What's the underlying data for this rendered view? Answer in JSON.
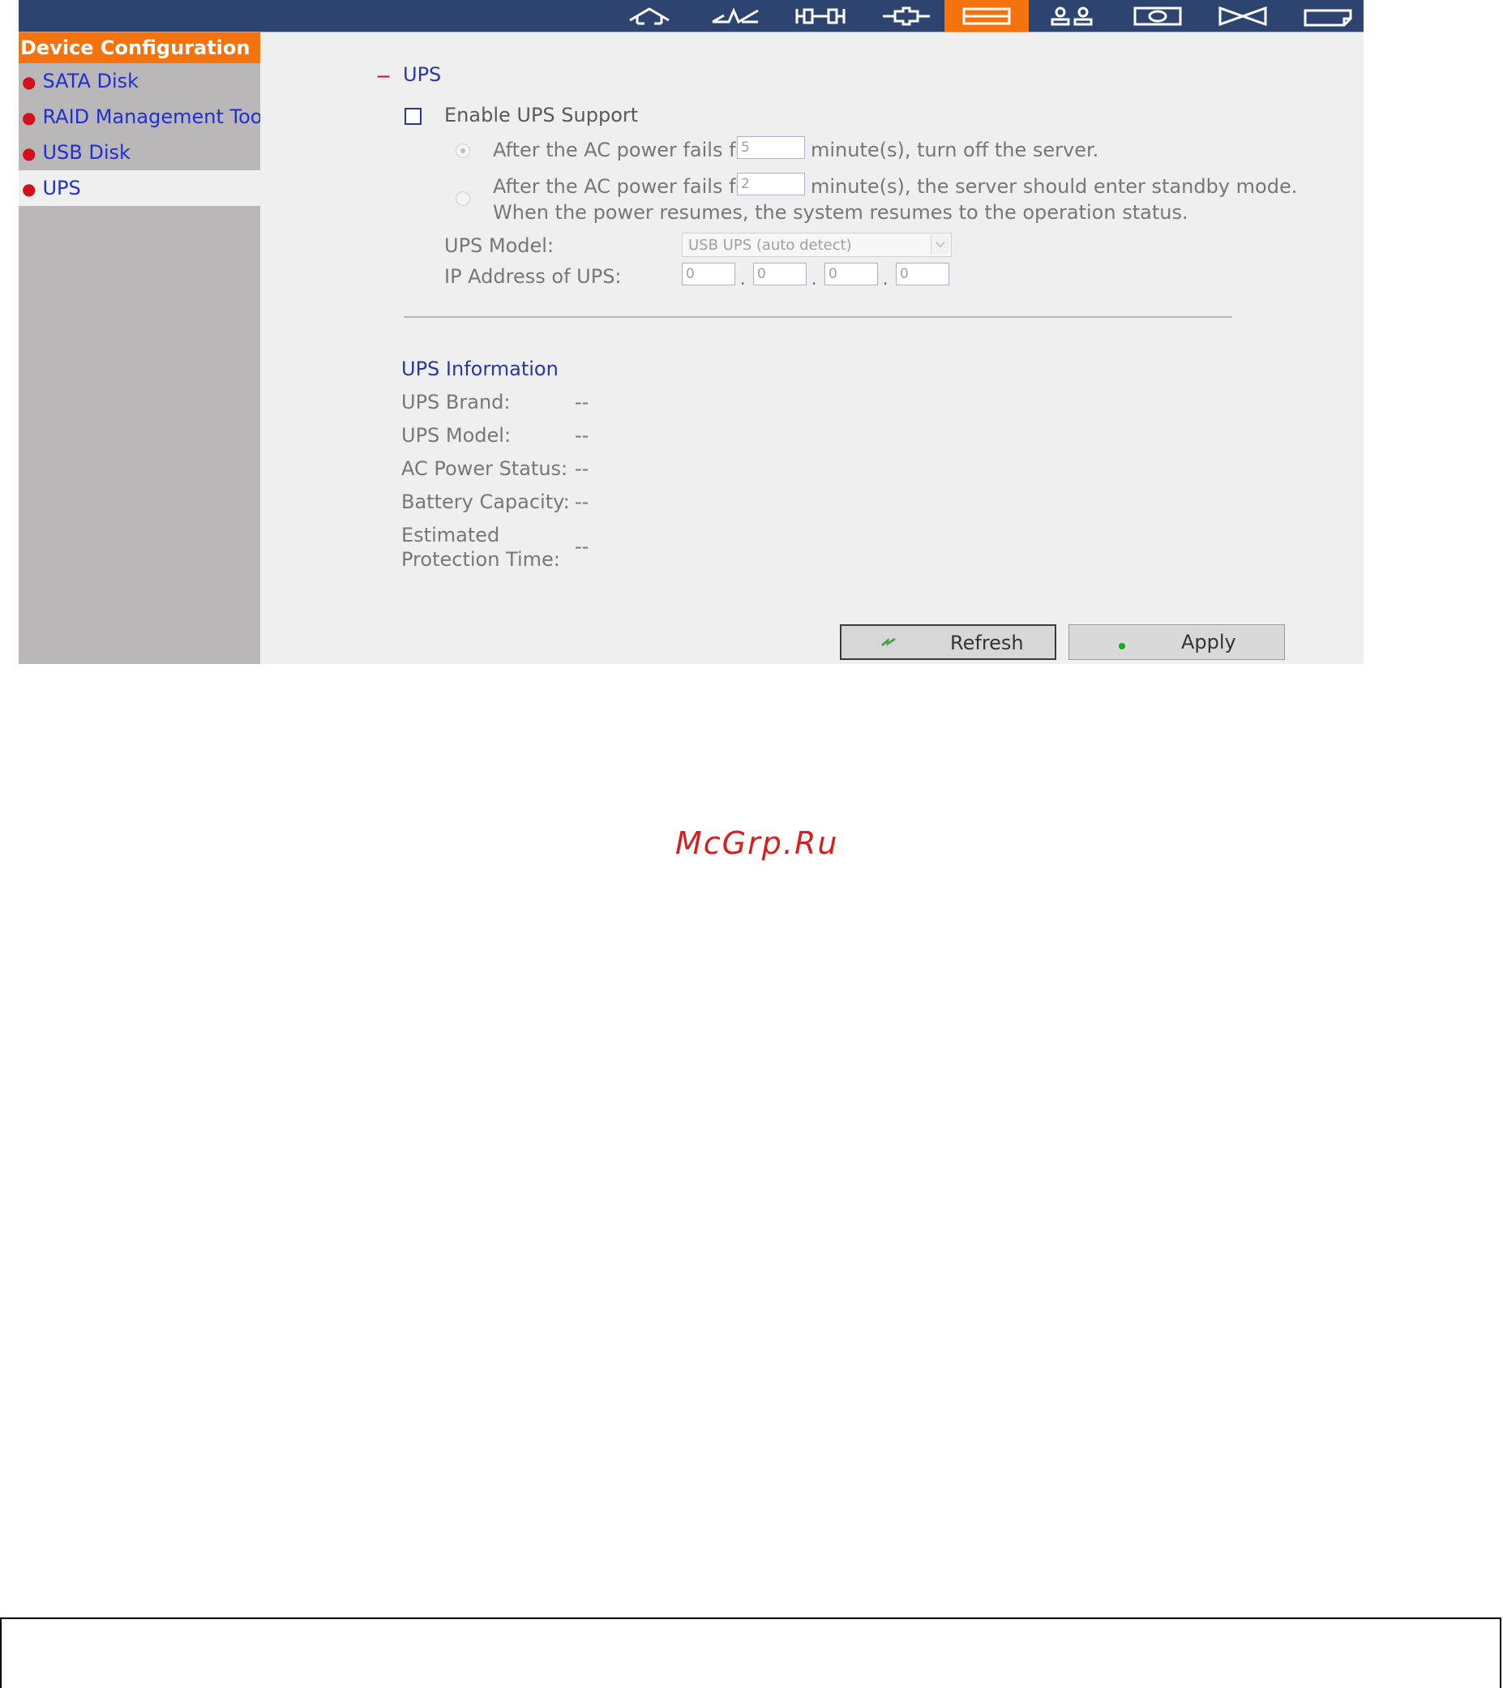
{
  "toolbar": {
    "icons": [
      "home-icon",
      "quick-config-icon",
      "system-admin-icon",
      "network-icon",
      "device-config-icon",
      "users-icon",
      "network-share-icon",
      "system-tools-icon",
      "event-log-icon"
    ],
    "active_index": 4
  },
  "sidebar": {
    "title": "Device Configuration",
    "items": [
      {
        "label": "SATA Disk"
      },
      {
        "label": "RAID Management Tool"
      },
      {
        "label": "USB Disk"
      },
      {
        "label": "UPS"
      }
    ],
    "active_item": "UPS"
  },
  "ups": {
    "section_marker": "−",
    "section_title": "UPS",
    "enable_label": "Enable UPS Support",
    "option1_prefix": "After the AC power fails for",
    "option1_value": "5",
    "option1_suffix": "minute(s), turn off the server.",
    "option2_prefix": "After the AC power fails for",
    "option2_value": "2",
    "option2_suffix": "minute(s), the server should enter standby mode.",
    "option2_line2": "When the power resumes, the system resumes to the operation status.",
    "model_label": "UPS Model:",
    "model_value": "USB UPS (auto detect)",
    "ip_label": "IP Address of UPS:",
    "ip": [
      "0",
      "0",
      "0",
      "0"
    ],
    "ip_sep": "."
  },
  "info": {
    "title": "UPS Information",
    "brand_label": "UPS Brand:",
    "brand_value": "--",
    "model_label": "UPS Model:",
    "model_value": "--",
    "ac_label": "AC Power Status:",
    "ac_value": "--",
    "battery_label": "Battery Capacity:",
    "battery_value": "--",
    "protection_label_1": "Estimated",
    "protection_label_2": "Protection Time:",
    "protection_value": "--"
  },
  "buttons": {
    "refresh": "Refresh",
    "apply": "Apply"
  },
  "watermark": "McGrp.Ru",
  "colors": {
    "topbar": "#2d4470",
    "accent": "#f5730f",
    "sidebar": "#bab7b9",
    "link": "#1f2fd2",
    "bullet": "#d4101c"
  }
}
